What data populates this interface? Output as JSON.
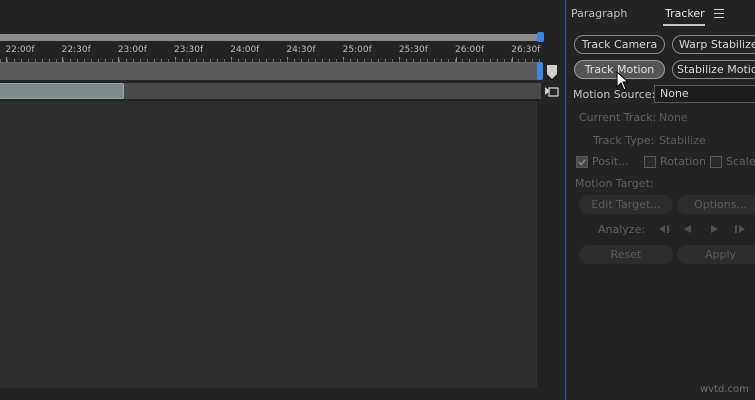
{
  "timeline": {
    "ruler_ticks": [
      "22:00f",
      "22:30f",
      "23:00f",
      "23:30f",
      "24:00f",
      "24:30f",
      "25:00f",
      "25:30f",
      "26:00f",
      "26:30f"
    ],
    "accent_color": "#3d86e0"
  },
  "panel": {
    "tabs": [
      {
        "label": "Paragraph",
        "active": false
      },
      {
        "label": "Tracker",
        "active": true
      }
    ],
    "menu_icon": "hamburger-menu-icon",
    "buttons": {
      "track_camera": "Track Camera",
      "warp_stabilizer": "Warp Stabilizer",
      "track_motion": "Track Motion",
      "stabilize_motion": "Stabilize Motion"
    },
    "motion_source": {
      "label": "Motion Source:",
      "value": "None"
    },
    "current_track": {
      "label": "Current Track:",
      "value": "None"
    },
    "track_type": {
      "label": "Track Type:",
      "value": "Stabilize"
    },
    "checkboxes": [
      {
        "label": "Posit...",
        "checked": true
      },
      {
        "label": "Rotation",
        "checked": false
      },
      {
        "label": "Scale",
        "checked": false
      }
    ],
    "motion_target": {
      "label": "Motion Target:"
    },
    "edit_target": "Edit Target...",
    "options": "Options...",
    "analyze": {
      "label": "Analyze:"
    },
    "reset": "Reset",
    "apply": "Apply",
    "border_color": "#2d5c9e"
  },
  "watermark": "wvtd.com"
}
